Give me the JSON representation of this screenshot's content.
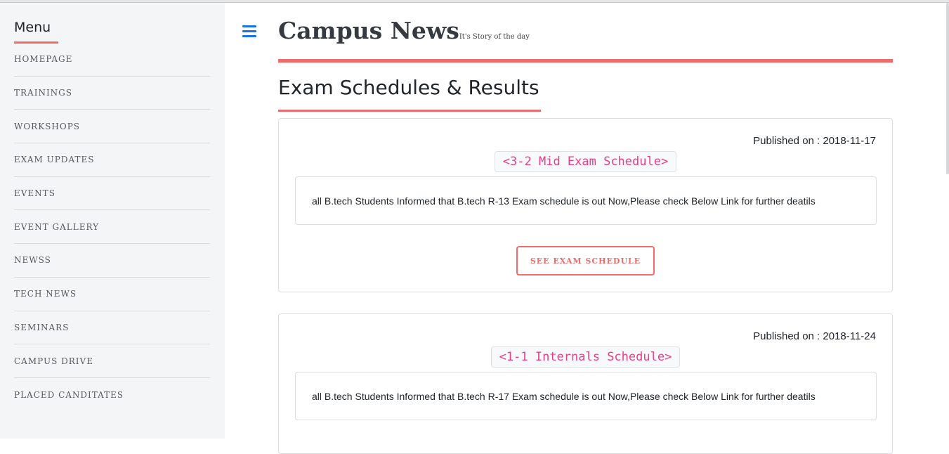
{
  "sidebar": {
    "title": "Menu",
    "items": [
      {
        "label": "HOMEPAGE"
      },
      {
        "label": "TRAININGS"
      },
      {
        "label": "WORKSHOPS"
      },
      {
        "label": "EXAM UPDATES"
      },
      {
        "label": "EVENTS"
      },
      {
        "label": "EVENT GALLERY"
      },
      {
        "label": "NEWSS"
      },
      {
        "label": "TECH NEWS"
      },
      {
        "label": "SEMINARS"
      },
      {
        "label": "CAMPUS DRIVE"
      },
      {
        "label": "PLACED CANDITATES"
      }
    ]
  },
  "header": {
    "menu_icon": "hamburger-icon",
    "title": "Campus News",
    "tagline": "It's Story of the day"
  },
  "section": {
    "heading": "Exam Schedules & Results"
  },
  "posts": [
    {
      "published": "Published on : 2018-11-17",
      "title": "<3-2 Mid Exam Schedule>",
      "body": "all B.tech Students Informed that B.tech R-13 Exam schedule is out Now,Please check Below Link for further deatils",
      "button": "SEE EXAM SCHEDULE"
    },
    {
      "published": "Published on : 2018-11-24",
      "title": "<1-1 Internals Schedule>",
      "body": "all B.tech Students Informed that B.tech R-17 Exam schedule is out Now,Please check Below Link for further deatils"
    }
  ],
  "colors": {
    "accent": "#f06b6b",
    "link_blue": "#1a73e8",
    "code_pink": "#e83e8c",
    "sidebar_bg": "#f4f5f7"
  }
}
